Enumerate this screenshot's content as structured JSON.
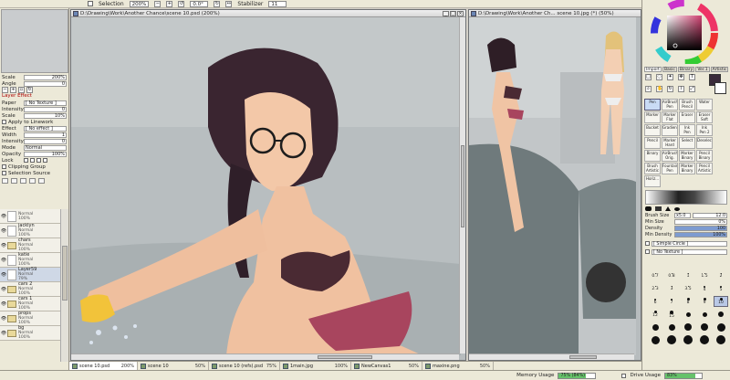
{
  "toolbar": {
    "selection_label": "Selection",
    "zoom": "200%",
    "rotation": "0.0°",
    "stabilizer_label": "Stabilizer",
    "stabilizer_value": "11"
  },
  "left_panel": {
    "scale_label": "Scale",
    "scale_value": "200%",
    "angle_label": "Angle",
    "angle_value": "0",
    "layer_effect_title": "Layer Effect",
    "paper_label": "Paper",
    "paper_value": "[ No Texture ]",
    "intensity_label": "Intensity",
    "intensity_value": "0",
    "scale2_label": "Scale",
    "scale2_value": "10%",
    "apply_linework": "Apply to Linework",
    "effect_label": "Effect",
    "effect_value": "[ No effect ]",
    "width_label": "Width",
    "width_value": "1",
    "intensity2_label": "Intensity",
    "intensity2_value": "0",
    "mode_label": "Mode",
    "mode_value": "Normal",
    "opacity_label": "Opacity",
    "opacity_value": "100%",
    "lock_label": "Lock",
    "clipping_group": "Clipping Group",
    "selection_source": "Selection Source"
  },
  "layers": [
    {
      "name": "",
      "mode": "Normal",
      "opacity": "100%",
      "folder": false,
      "selected": false
    },
    {
      "name": "jacklyn",
      "mode": "Normal",
      "opacity": "100%",
      "folder": false,
      "selected": false
    },
    {
      "name": "chars",
      "mode": "Normal",
      "opacity": "100%",
      "folder": true,
      "selected": false
    },
    {
      "name": "katie",
      "mode": "Normal",
      "opacity": "100%",
      "folder": false,
      "selected": false
    },
    {
      "name": "Layer59",
      "mode": "Normal",
      "opacity": "79%",
      "folder": false,
      "selected": true
    },
    {
      "name": "cars 2",
      "mode": "Normal",
      "opacity": "100%",
      "folder": true,
      "selected": false
    },
    {
      "name": "cars 1",
      "mode": "Normal",
      "opacity": "100%",
      "folder": true,
      "selected": false
    },
    {
      "name": "props",
      "mode": "Normal",
      "opacity": "100%",
      "folder": true,
      "selected": false
    },
    {
      "name": "bg",
      "mode": "Normal",
      "opacity": "100%",
      "folder": true,
      "selected": false
    }
  ],
  "windows": {
    "main_title": "D:\\Drawing\\Work\\Another Chance\\scene 10.psd (200%)",
    "second_title": "D:\\Drawing\\Work\\Another Ch... scene 10.jpg (*) (50%)"
  },
  "right_panel": {
    "tabs": [
      "Import",
      "Basic",
      "Binary",
      "Ver.1",
      "Artistic"
    ],
    "tools": [
      {
        "l1": "Pen",
        "l2": "",
        "active": true
      },
      {
        "l1": "AirBrush",
        "l2": "Pen",
        "active": false
      },
      {
        "l1": "Brush",
        "l2": "Pencil",
        "active": false
      },
      {
        "l1": "Water",
        "l2": "",
        "active": false
      },
      {
        "l1": "Marker",
        "l2": "",
        "active": false
      },
      {
        "l1": "Marker",
        "l2": "Flat",
        "active": false
      },
      {
        "l1": "Eraser",
        "l2": "",
        "active": false
      },
      {
        "l1": "Eraser",
        "l2": "Soft",
        "active": false
      },
      {
        "l1": "Bucket",
        "l2": "",
        "active": false
      },
      {
        "l1": "Gradient",
        "l2": "",
        "active": false
      },
      {
        "l1": "Ink",
        "l2": "Pen",
        "active": false
      },
      {
        "l1": "Ink",
        "l2": "Pen 2",
        "active": false
      },
      {
        "l1": "Pencil",
        "l2": "",
        "active": false
      },
      {
        "l1": "Marker",
        "l2": "Hard",
        "active": false
      },
      {
        "l1": "Select",
        "l2": "",
        "active": false
      },
      {
        "l1": "Deselect",
        "l2": "",
        "active": false
      },
      {
        "l1": "Binary",
        "l2": "",
        "active": false
      },
      {
        "l1": "AirBrush",
        "l2": "Orig.",
        "active": false
      },
      {
        "l1": "Marker",
        "l2": "Binary",
        "active": false
      },
      {
        "l1": "Pencil",
        "l2": "Binary",
        "active": false
      },
      {
        "l1": "Brush",
        "l2": "Artistic",
        "active": false
      },
      {
        "l1": "Fountain",
        "l2": "Pen",
        "active": false
      },
      {
        "l1": "Marker",
        "l2": "Binary",
        "active": false
      },
      {
        "l1": "Pencil",
        "l2": "Artistic",
        "active": false
      },
      {
        "l1": "Horiz...",
        "l2": "",
        "active": false
      }
    ],
    "brush_size_label": "Brush Size",
    "brush_mult": "x5.0",
    "brush_size_value": "12.0",
    "min_size_label": "Min Size",
    "min_size_value": "0%",
    "min_size_fill": 0,
    "density_label": "Density",
    "density_value": "100",
    "density_fill": 100,
    "min_density_label": "Min Density",
    "min_density_value": "100%",
    "min_density_fill": 100,
    "shape_value": "[ Simple Circle ]",
    "texture_value": "[ No Texture ]",
    "sizes": [
      {
        "label": "",
        "d": 0
      },
      {
        "label": "",
        "d": 0
      },
      {
        "label": "",
        "d": 0
      },
      {
        "label": "",
        "d": 0
      },
      {
        "label": "",
        "d": 0
      },
      {
        "label": "0.7",
        "d": 1
      },
      {
        "label": "0.8",
        "d": 1
      },
      {
        "label": "1",
        "d": 1
      },
      {
        "label": "1.5",
        "d": 1
      },
      {
        "label": "2",
        "d": 1
      },
      {
        "label": "2.3",
        "d": 1
      },
      {
        "label": "3",
        "d": 1
      },
      {
        "label": "3.5",
        "d": 1
      },
      {
        "label": "4",
        "d": 2
      },
      {
        "label": "5",
        "d": 2
      },
      {
        "label": "6",
        "d": 2
      },
      {
        "label": "7",
        "d": 2
      },
      {
        "label": "8",
        "d": 3
      },
      {
        "label": "9",
        "d": 3
      },
      {
        "label": "10",
        "d": 3
      },
      {
        "label": "12",
        "d": 3
      },
      {
        "label": "15",
        "d": 4
      },
      {
        "label": "",
        "d": 5
      },
      {
        "label": "",
        "d": 5
      },
      {
        "label": "",
        "d": 6
      },
      {
        "label": "",
        "d": 7
      },
      {
        "label": "",
        "d": 7
      },
      {
        "label": "",
        "d": 8
      },
      {
        "label": "",
        "d": 8
      },
      {
        "label": "",
        "d": 9
      },
      {
        "label": "",
        "d": 9
      },
      {
        "label": "",
        "d": 10
      },
      {
        "label": "",
        "d": 10
      },
      {
        "label": "",
        "d": 10
      },
      {
        "label": "",
        "d": 10
      }
    ]
  },
  "taskbar": [
    {
      "name": "scene 10.psd",
      "zoom": "200%",
      "active": true
    },
    {
      "name": "scene 10",
      "zoom": "50%",
      "active": false
    },
    {
      "name": "scene 10 (refs).psd",
      "zoom": "75%",
      "active": false
    },
    {
      "name": "1main.jpg",
      "zoom": "100%",
      "active": false
    },
    {
      "name": "NewCanvas1",
      "zoom": "50%",
      "active": false
    },
    {
      "name": "maxine.png",
      "zoom": "50%",
      "active": false
    }
  ],
  "status": {
    "memory_label": "Memory Usage",
    "memory_value": "75% (84%)",
    "memory_fill": 75,
    "drive_label": "Drive Usage",
    "drive_value": "83%",
    "drive_fill": 83
  },
  "colors": {
    "primary": "#3a2a3a",
    "secondary": "#ffffff",
    "wheel_square_hue": "#d04070"
  }
}
